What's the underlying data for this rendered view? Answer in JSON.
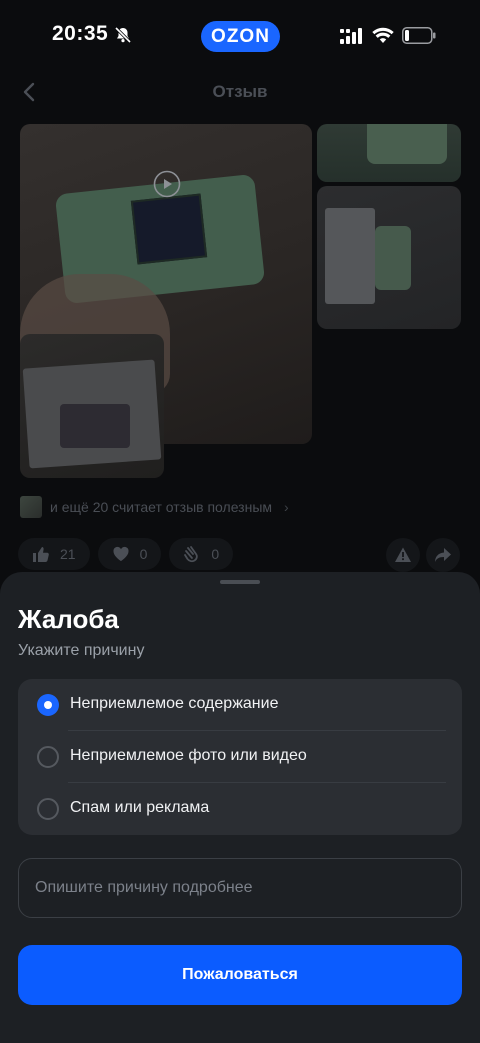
{
  "status_bar": {
    "time": "20:35",
    "brand": "OZON",
    "icons": [
      "bell-slash-icon",
      "signal-icon",
      "wifi-icon",
      "battery-icon"
    ]
  },
  "header": {
    "title": "Отзыв",
    "back_icon": "chevron-left-icon"
  },
  "review": {
    "photos": [
      {
        "name": "review-photo-video",
        "has_play": true
      },
      {
        "name": "review-photo-2",
        "has_play": false
      },
      {
        "name": "review-photo-3",
        "has_play": false
      },
      {
        "name": "review-photo-4",
        "has_play": false
      }
    ],
    "helpful_text": "и ещё 20 считает отзыв полезным",
    "reactions": [
      {
        "icon": "thumbs-up-icon",
        "count": "21"
      },
      {
        "icon": "heart-icon",
        "count": "0"
      },
      {
        "icon": "clap-icon",
        "count": "0"
      }
    ],
    "actions": [
      "report-icon",
      "share-icon"
    ]
  },
  "sheet": {
    "title": "Жалоба",
    "subtitle": "Укажите причину",
    "options": [
      {
        "label": "Неприемлемое содержание",
        "selected": true
      },
      {
        "label": "Неприемлемое фото или видео",
        "selected": false
      },
      {
        "label": "Спам или реклама",
        "selected": false
      }
    ],
    "details_placeholder": "Опишите причину подробнее",
    "details_value": "",
    "submit_label": "Пожаловаться"
  },
  "colors": {
    "accent": "#0b5cff",
    "sheet_bg": "#1d2024",
    "page_bg": "#0b0c0e"
  }
}
